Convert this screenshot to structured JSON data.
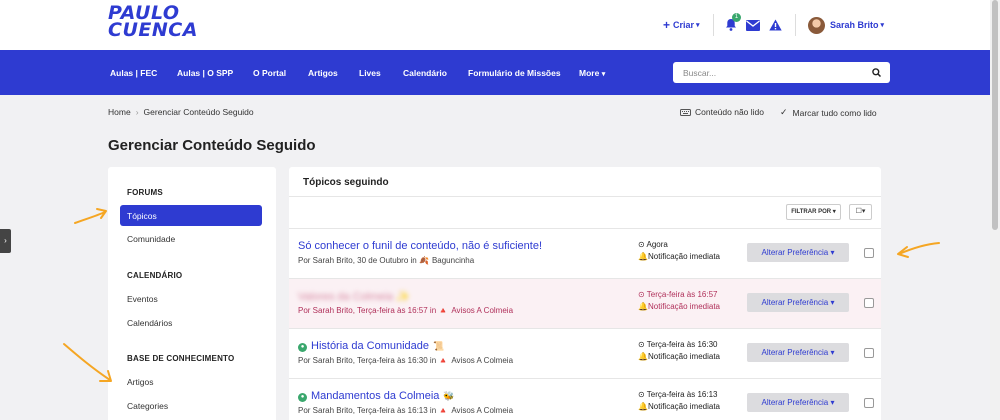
{
  "logo": {
    "line1": "PAULO",
    "line2": "CUENCA"
  },
  "header": {
    "criar_label": "Criar",
    "notification_count": "1",
    "user_name": "Sarah Brito"
  },
  "nav": {
    "items": [
      "Aulas | FEC",
      "Aulas | O SPP",
      "O Portal",
      "Artigos",
      "Lives",
      "Calendário",
      "Formulário de Missões",
      "More"
    ],
    "search_placeholder": "Buscar..."
  },
  "breadcrumb": {
    "home": "Home",
    "current": "Gerenciar Conteúdo Seguido"
  },
  "top_actions": {
    "unread": "Conteúdo não lido",
    "mark_read": "Marcar tudo como lido"
  },
  "page_title": "Gerenciar Conteúdo Seguido",
  "sidebar": {
    "section_forums": "FORUMS",
    "item_topicos": "Tópicos",
    "item_comunidade": "Comunidade",
    "section_calendario": "CALENDÁRIO",
    "item_eventos": "Eventos",
    "item_calendarios": "Calendários",
    "section_base": "BASE DE CONHECIMENTO",
    "item_artigos": "Artigos",
    "item_categories": "Categories"
  },
  "main": {
    "heading": "Tópicos seguindo",
    "filter_label": "FILTRAR POR",
    "pref_label": "Alterar Preferência",
    "rows": [
      {
        "title": "Só conhecer o funil de conteúdo, não é suficiente!",
        "by": "Por Sarah Brito, 30 de Outubro in",
        "forum": "Baguncinha",
        "when": "Agora",
        "notif": "Notificação imediata"
      },
      {
        "title": "Valores da Colmeia",
        "by": "Por Sarah Brito, Terça-feira às 16:57 in",
        "forum": "Avisos A Colmeia",
        "when": "Terça-feira às 16:57",
        "notif": "Notificação imediata"
      },
      {
        "title": "História da Comunidade",
        "by": "Por Sarah Brito, Terça-feira às 16:30 in",
        "forum": "Avisos A Colmeia",
        "when": "Terça-feira às 16:30",
        "notif": "Notificação imediata"
      },
      {
        "title": "Mandamentos da Colmeia",
        "by": "Por Sarah Brito, Terça-feira às 16:13 in",
        "forum": "Avisos A Colmeia",
        "when": "Terça-feira às 16:13",
        "notif": "Notificação imediata"
      }
    ]
  },
  "colors": {
    "brand": "#2e3bd1",
    "annotation_arrow": "#f5a623",
    "unread_row": "#fbf1f4"
  }
}
